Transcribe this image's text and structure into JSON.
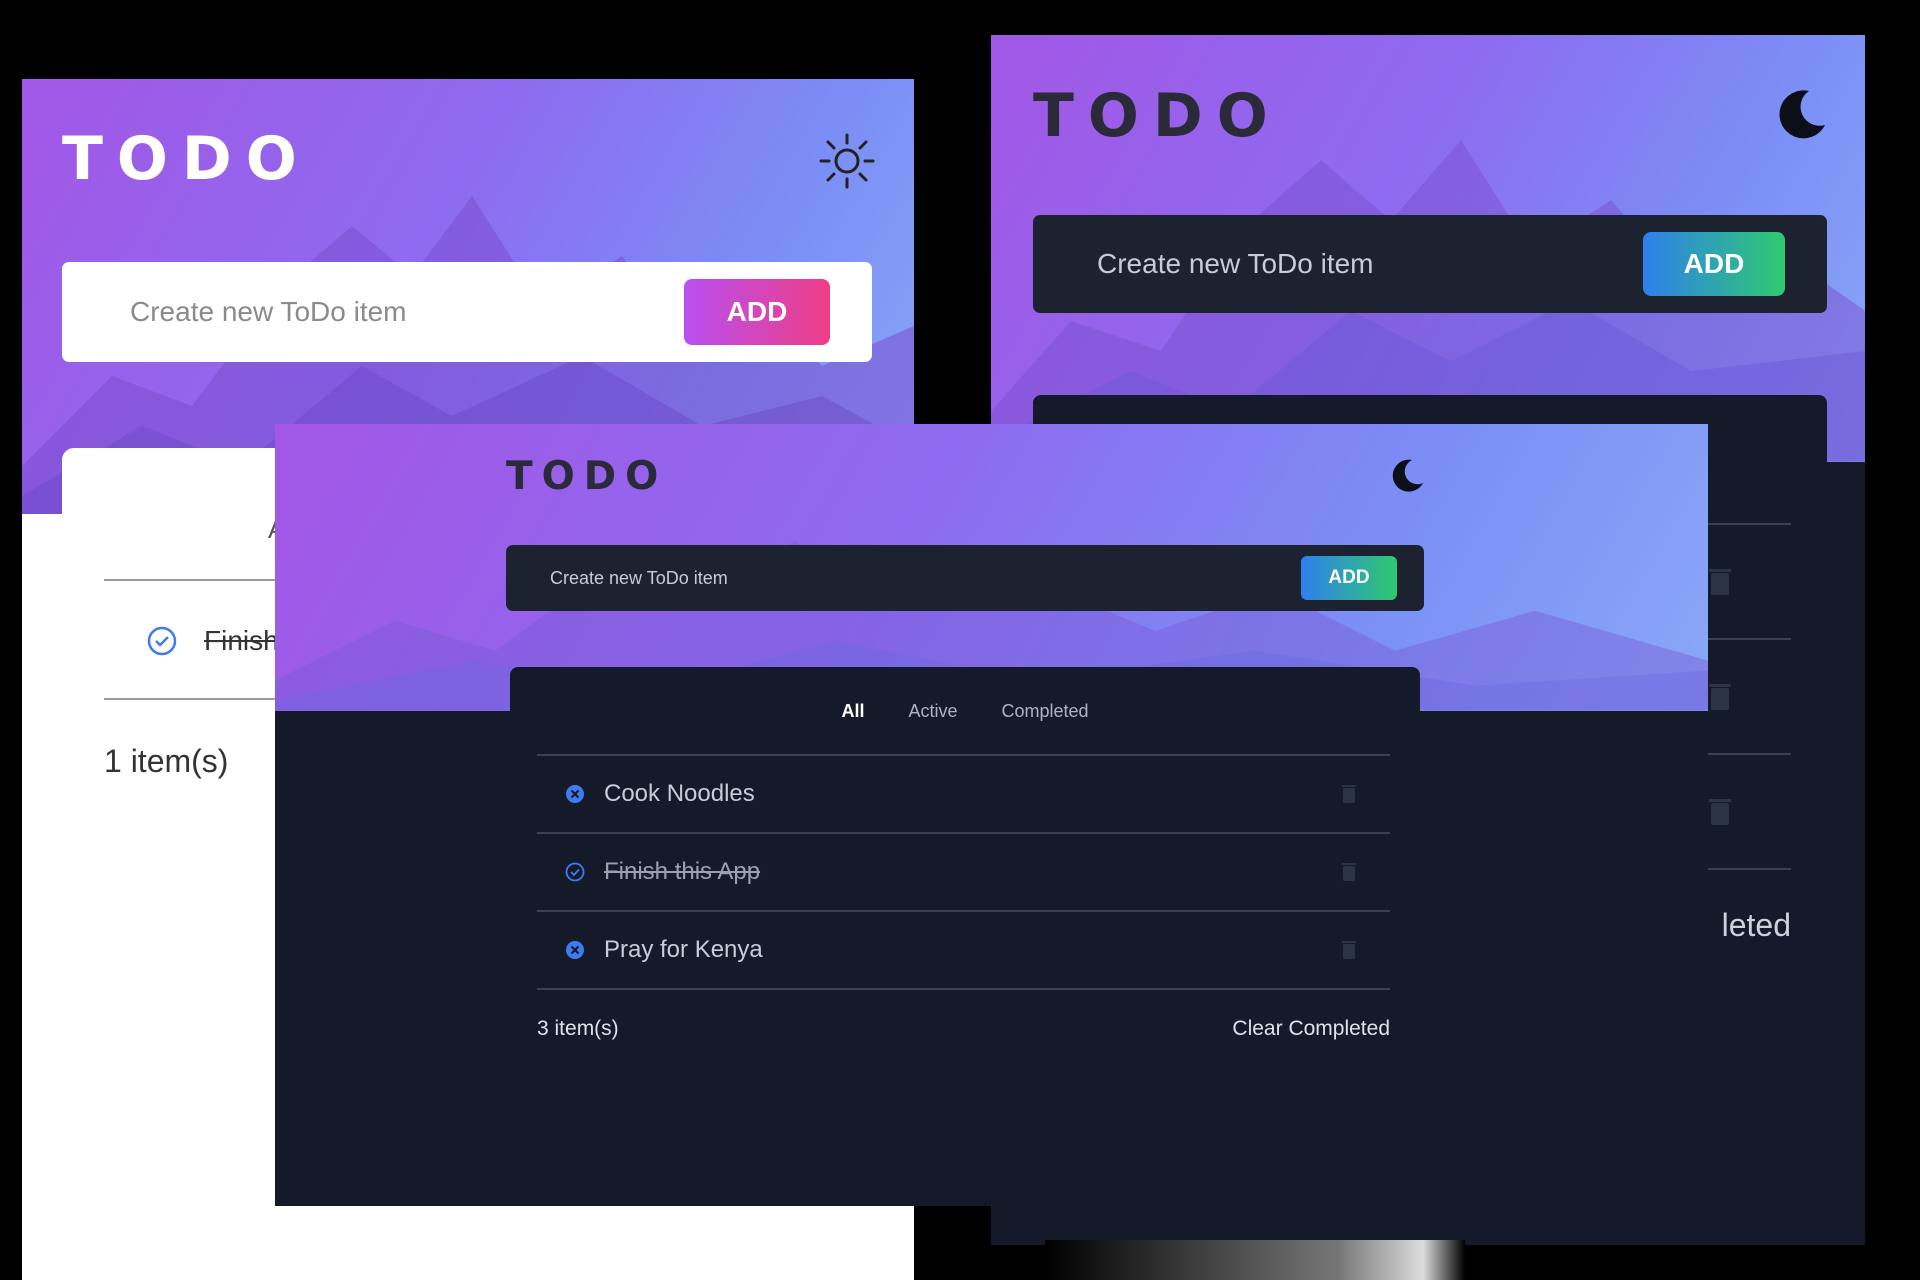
{
  "light_screen": {
    "title": "TODO",
    "theme_icon": "sun-icon",
    "input_placeholder": "Create new ToDo item",
    "add_label": "ADD",
    "filter_fragment": "A",
    "todo_fragment": "Finish",
    "count": "1 item(s)"
  },
  "dark_screen_back": {
    "title": "TODO",
    "theme_icon": "moon-icon",
    "input_placeholder": "Create new ToDo item",
    "add_label": "ADD",
    "clear_fragment": "leted"
  },
  "dark_screen_front": {
    "title": "TODO",
    "theme_icon": "moon-icon",
    "input_placeholder": "Create new ToDo item",
    "add_label": "ADD",
    "tabs": [
      {
        "label": "All",
        "active": true
      },
      {
        "label": "Active",
        "active": false
      },
      {
        "label": "Completed",
        "active": false
      }
    ],
    "todos": [
      {
        "text": "Cook Noodles",
        "completed": false,
        "status_icon": "x-circle-icon"
      },
      {
        "text": "Finish this App",
        "completed": true,
        "status_icon": "check-circle-icon"
      },
      {
        "text": "Pray for Kenya",
        "completed": false,
        "status_icon": "x-circle-icon"
      }
    ],
    "count": "3 item(s)",
    "clear_completed": "Clear Completed"
  },
  "colors": {
    "dark_bg": "#151a2b",
    "accent_blue": "#3f7bf0",
    "add_gradient_dark": [
      "#2f80ed",
      "#2fc96f"
    ],
    "add_gradient_light": [
      "#b94ff0",
      "#ee3e86"
    ]
  }
}
